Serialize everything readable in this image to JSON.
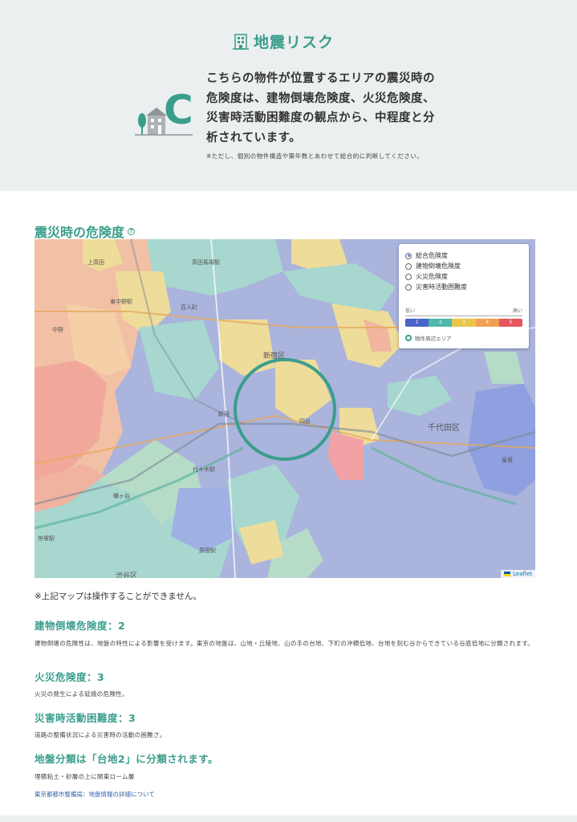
{
  "hero": {
    "title": "地震リスク",
    "grade": "C",
    "description": "こちらの物件が位置するエリアの震災時の危険度は、建物倒壊危険度、火災危険度、災害時活動困難度の観点から、中程度と分析されています。",
    "note": "※ただし、個別の物件構造や築年数とあわせて総合的に判断してください。"
  },
  "map_section": {
    "title": "震災時の危険度",
    "help_icon": "question-circle-icon",
    "legend": {
      "options": [
        {
          "label": "総合危険度",
          "selected": true
        },
        {
          "label": "建物倒壊危険度",
          "selected": false
        },
        {
          "label": "火災危険度",
          "selected": false
        },
        {
          "label": "災害時活動困難度",
          "selected": false
        }
      ],
      "low_label": "低い",
      "high_label": "高い",
      "levels": [
        {
          "value": "1",
          "color": "#4a64c8"
        },
        {
          "value": "2",
          "color": "#4fb8ad"
        },
        {
          "value": "3",
          "color": "#e8c64a"
        },
        {
          "value": "4",
          "color": "#f0a052"
        },
        {
          "value": "5",
          "color": "#e5565e"
        }
      ],
      "area_label": "物件周辺エリア"
    },
    "map_labels": {
      "kamitakada": "上高田",
      "higashinakano": "東中野駅",
      "nakano": "中野",
      "takadanobaba": "高田馬場駅",
      "okubo": "百人町",
      "shinjuku_ku": "新宿区",
      "shinjuku": "新宿",
      "yotsuya": "四谷",
      "chiyoda": "千代田区",
      "yoyogi": "代々木駅",
      "hatagaya": "幡ヶ谷",
      "sasazuka": "笹塚駅",
      "harajuku": "原宿駅",
      "shibuya": "渋谷区",
      "kokyo": "皇居"
    },
    "attribution": "Leaflet",
    "note": "※上記マップは操作することができません。"
  },
  "details": {
    "building": {
      "title": "建物倒壊危険度：2",
      "text": "建物倒壊の危険性は、地盤の特性による影響を受けます。東京の地盤は、山地・丘陵地、山の手の台地、下町の沖積低地、台地を刻む谷からできている谷底低地に分類されます。"
    },
    "fire": {
      "title": "火災危険度：3",
      "text": "火災の発生による延焼の危険性。"
    },
    "activity": {
      "title": "災害時活動困難度：3",
      "text": "道路の整備状況による災害時の活動の困難さ。"
    },
    "ground": {
      "title": "地盤分類は「台地2」に分類されます。",
      "text": "埋積粘土・砂層の上に関東ローム層",
      "link": "東京都都市整備局：地盤情報の詳細について"
    }
  }
}
